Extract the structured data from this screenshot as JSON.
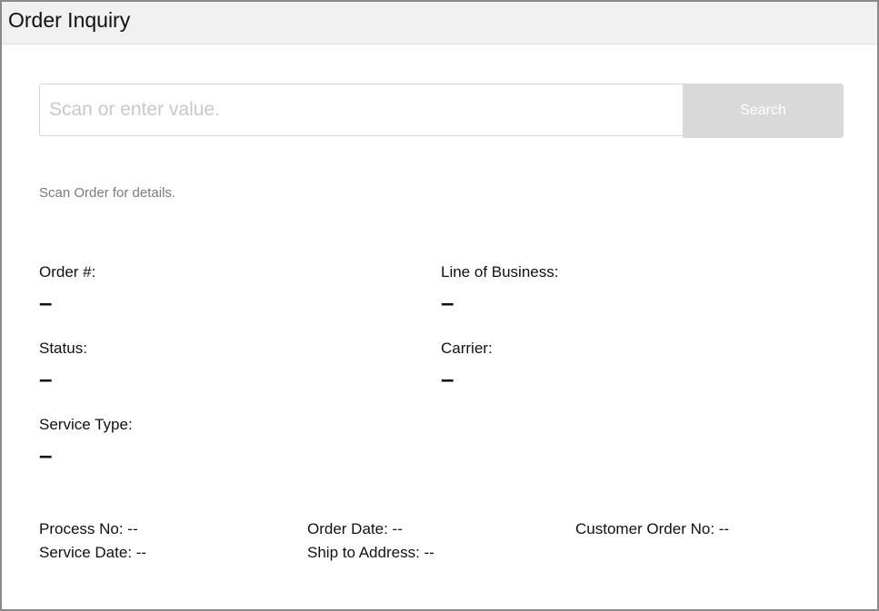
{
  "window": {
    "title": "Order Inquiry"
  },
  "search": {
    "placeholder": "Scan or enter value.",
    "value": "",
    "button_label": "Search"
  },
  "hint": "Scan Order for details.",
  "fields": {
    "order_no": {
      "label": "Order #:",
      "value": "–"
    },
    "line_of_business": {
      "label": "Line of Business:",
      "value": "–"
    },
    "status": {
      "label": "Status:",
      "value": "–"
    },
    "carrier": {
      "label": "Carrier:",
      "value": "–"
    },
    "service_type": {
      "label": "Service Type:",
      "value": "–"
    }
  },
  "meta": {
    "process_no": "Process No: --",
    "order_date": "Order Date: --",
    "customer_order_no": "Customer Order No: --",
    "service_date": "Service Date: --",
    "ship_to_address": "Ship to Address: --"
  }
}
